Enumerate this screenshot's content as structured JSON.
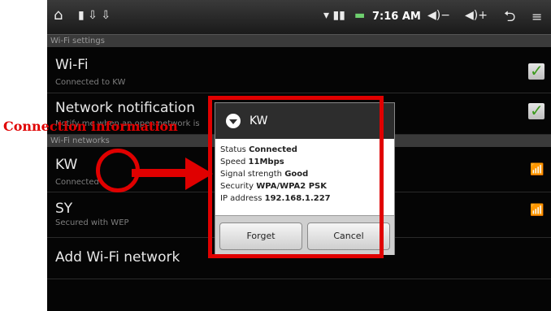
{
  "statusbar": {
    "time": "7:16 AM",
    "icons": [
      "home-icon",
      "notification-icons",
      "signal-icon",
      "battery-icon",
      "volume-down-icon",
      "volume-up-icon",
      "back-icon",
      "menu-icon"
    ]
  },
  "sections": {
    "wifi_settings": "Wi-Fi settings",
    "wifi_networks": "Wi-Fi networks"
  },
  "rows": {
    "wifi": {
      "title": "Wi-Fi",
      "sub": "Connected to KW"
    },
    "notif": {
      "title": "Network notification",
      "sub": "Notify me when an open network is"
    },
    "kw": {
      "title": "KW",
      "sub": "Connected"
    },
    "sy": {
      "title": "SY",
      "sub": "Secured with WEP"
    },
    "add": {
      "title": "Add Wi-Fi network"
    }
  },
  "dialog": {
    "title": "KW",
    "info": [
      {
        "label": "Status",
        "value": "Connected"
      },
      {
        "label": "Speed",
        "value": "11Mbps"
      },
      {
        "label": "Signal strength",
        "value": "Good"
      },
      {
        "label": "Security",
        "value": "WPA/WPA2 PSK"
      },
      {
        "label": "IP address",
        "value": "192.168.1.227"
      }
    ],
    "forget": "Forget",
    "cancel": "Cancel"
  },
  "annotation": "Connection information",
  "colors": {
    "highlight": "#e00000",
    "check": "#3c9a1c"
  }
}
